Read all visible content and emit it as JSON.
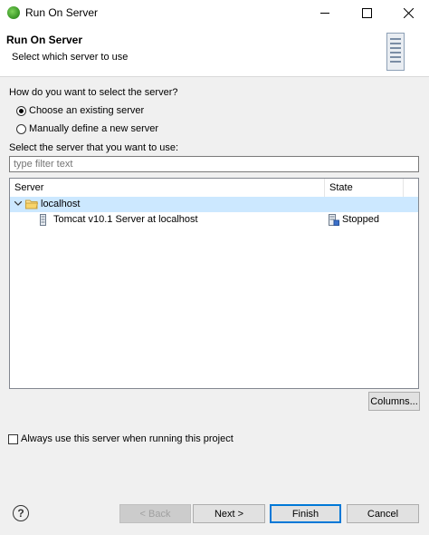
{
  "window": {
    "title": "Run On Server"
  },
  "banner": {
    "title": "Run On Server",
    "description": "Select which server to use"
  },
  "selection": {
    "question": "How do you want to select the server?",
    "option_existing": "Choose an existing server",
    "option_manual": "Manually define a new server",
    "selected": "existing"
  },
  "server_list": {
    "label": "Select the server that you want to use:",
    "filter_placeholder": "type filter text",
    "columns": [
      "Server",
      "State"
    ],
    "rows": [
      {
        "name": "localhost",
        "state": ""
      },
      {
        "name": "Tomcat v10.1 Server at localhost",
        "state": "Stopped"
      }
    ]
  },
  "columns_button": "Columns...",
  "always_use_label": "Always use this server when running this project",
  "footer": {
    "back": "< Back",
    "next": "Next >",
    "finish": "Finish",
    "cancel": "Cancel"
  },
  "colors": {
    "selection_row": "#cce8ff",
    "primary_border": "#0078d7"
  }
}
